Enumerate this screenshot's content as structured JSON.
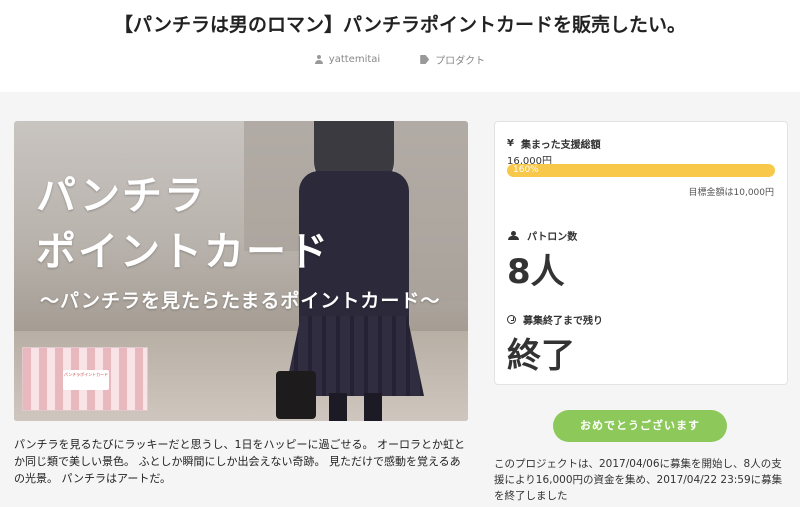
{
  "page": {
    "title": "【パンチラは男のロマン】パンチラポイントカードを販売したい。",
    "author": "yattemitai",
    "category": "プロダクト"
  },
  "hero": {
    "line1": "パンチラ",
    "line2": "ポイントカード",
    "line3": "〜パンチラを見たらたまるポイントカード〜",
    "card_label": "パンチラポイントカード"
  },
  "funding": {
    "raised_label": "集まった支援総額",
    "raised_value": "16,000円",
    "progress_text": "160%",
    "progress_percent": 160,
    "goal_text": "目標金額は10,000円",
    "patron_label": "パトロン数",
    "patron_value": "8人",
    "remaining_label": "募集終了まで残り",
    "remaining_value": "終了"
  },
  "button": {
    "label": "おめでとうございます"
  },
  "description": "パンチラを見るたびにラッキーだと思うし、1日をハッピーに過ごせる。 オーロラとか虹とか同じ類で美しい景色。 ふとしか瞬間にしか出会えない奇跡。 見ただけで感動を覚えるあの光景。 パンチラはアートだ。",
  "summary": "このプロジェクトは、2017/04/06に募集を開始し、8人の支援により16,000円の資金を集め、2017/04/22 23:59に募集を終了しました",
  "icons": {
    "author": "user-icon",
    "category": "tag-icon",
    "raised": "yen-icon",
    "patron": "users-icon",
    "remaining": "clock-icon"
  },
  "colors": {
    "progress": "#f7c84a",
    "button": "#8cc95a"
  }
}
